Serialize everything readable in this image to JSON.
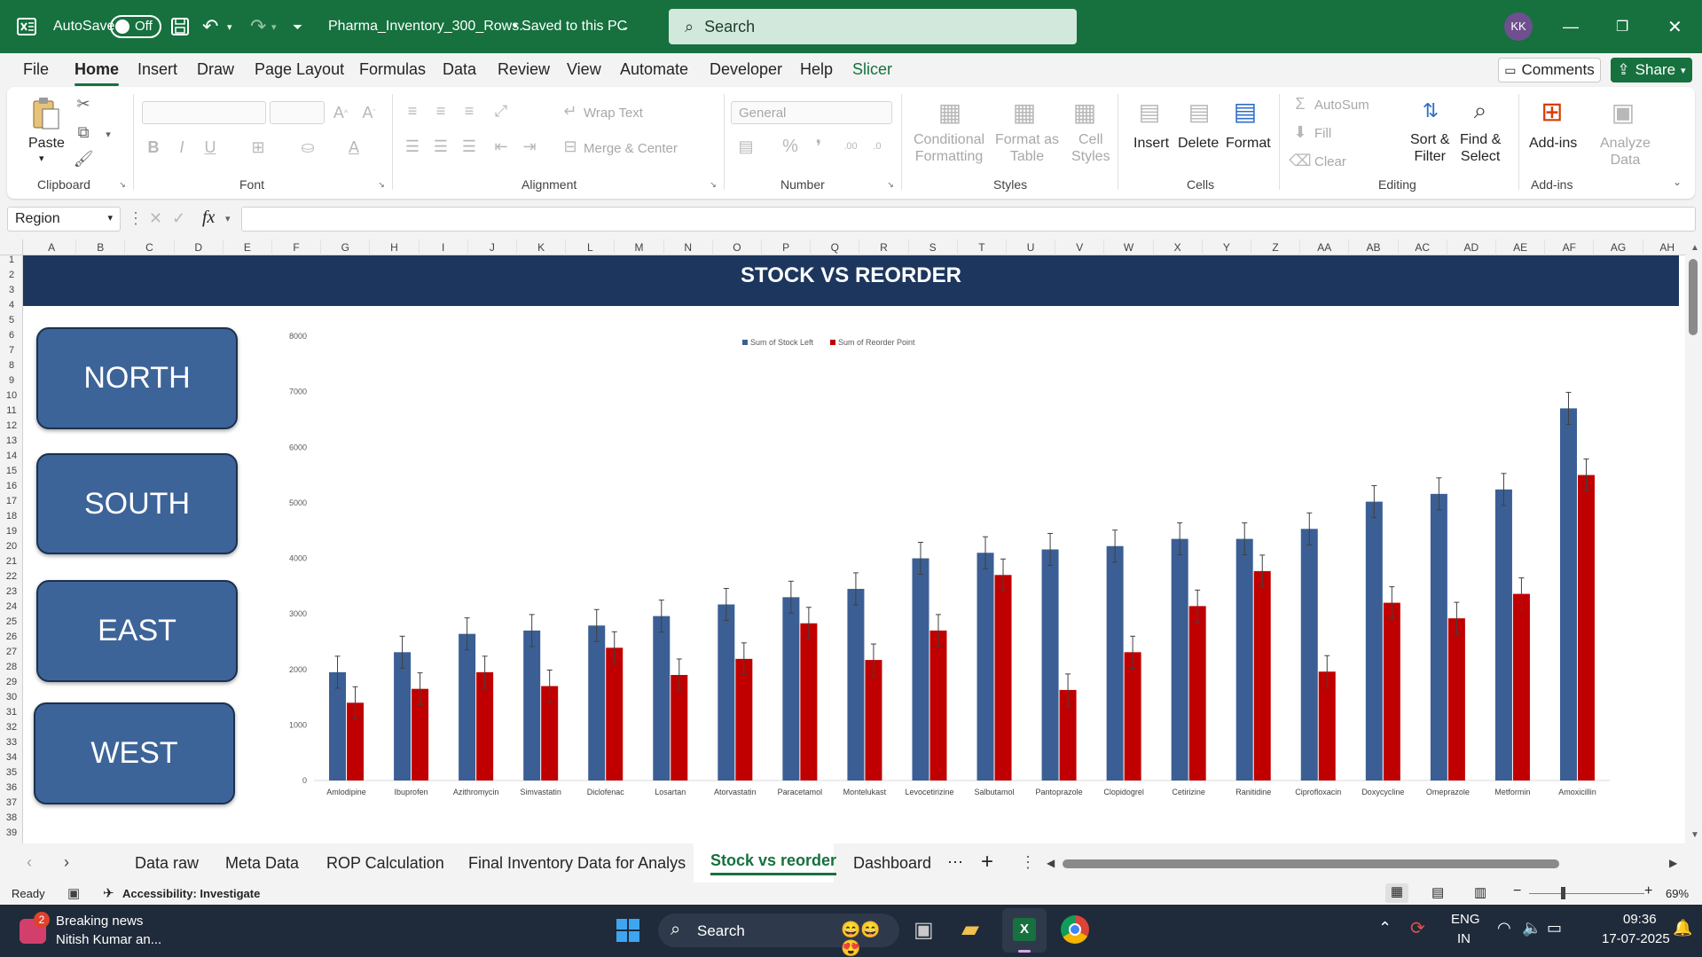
{
  "titlebar": {
    "autosave_label": "AutoSave",
    "autosave_state": "Off",
    "filename": "Pharma_Inventory_300_Rows...",
    "save_status": "• Saved to this PC",
    "search_placeholder": "Search",
    "avatar_initials": "KK"
  },
  "menu": [
    "File",
    "Home",
    "Insert",
    "Draw",
    "Page Layout",
    "Formulas",
    "Data",
    "Review",
    "View",
    "Automate",
    "Developer",
    "Help",
    "Slicer"
  ],
  "menu_active": "Home",
  "menu_right": {
    "comments": "Comments",
    "share": "Share"
  },
  "ribbon": {
    "clipboard": {
      "paste": "Paste",
      "group": "Clipboard"
    },
    "font": {
      "group": "Font"
    },
    "alignment": {
      "wrap": "Wrap Text",
      "merge": "Merge & Center",
      "group": "Alignment"
    },
    "number": {
      "format": "General",
      "group": "Number"
    },
    "styles": {
      "cond1": "Conditional",
      "cond2": "Formatting",
      "fmt1": "Format as",
      "fmt2": "Table",
      "cell1": "Cell",
      "cell2": "Styles",
      "group": "Styles"
    },
    "cells": {
      "insert": "Insert",
      "delete": "Delete",
      "format": "Format",
      "group": "Cells"
    },
    "editing": {
      "autosum": "AutoSum",
      "fill": "Fill",
      "clear": "Clear",
      "sort1": "Sort &",
      "sort2": "Filter",
      "find1": "Find &",
      "find2": "Select",
      "group": "Editing"
    },
    "addins": {
      "addins": "Add-ins",
      "analyze1": "Analyze",
      "analyze2": "Data",
      "group": "Add-ins"
    }
  },
  "formula_bar": {
    "name_box": "Region",
    "formula": ""
  },
  "columns": [
    "A",
    "B",
    "C",
    "D",
    "E",
    "F",
    "G",
    "H",
    "I",
    "J",
    "K",
    "L",
    "M",
    "N",
    "O",
    "P",
    "Q",
    "R",
    "S",
    "T",
    "U",
    "V",
    "W",
    "X",
    "Y",
    "Z",
    "AA",
    "AB",
    "AC",
    "AD",
    "AE",
    "AF",
    "AG",
    "AH"
  ],
  "rows": [
    "1",
    "2",
    "3",
    "4",
    "5",
    "6",
    "7",
    "8",
    "9",
    "10",
    "11",
    "12",
    "13",
    "14",
    "15",
    "16",
    "17",
    "18",
    "19",
    "20",
    "21",
    "22",
    "23",
    "24",
    "25",
    "26",
    "27",
    "28",
    "29",
    "30",
    "31",
    "32",
    "33",
    "34",
    "35",
    "36",
    "37",
    "38",
    "39"
  ],
  "banner_title": "STOCK VS REORDER",
  "slicers": [
    "NORTH",
    "SOUTH",
    "EAST",
    "WEST"
  ],
  "chart_data": {
    "type": "bar",
    "categories": [
      "Amlodipine",
      "Ibuprofen",
      "Azithromycin",
      "Simvastatin",
      "Diclofenac",
      "Losartan",
      "Atorvastatin",
      "Paracetamol",
      "Montelukast",
      "Levocetirizine",
      "Salbutamol",
      "Pantoprazole",
      "Clopidogrel",
      "Cetirizine",
      "Ranitidine",
      "Ciprofloxacin",
      "Doxycycline",
      "Omeprazole",
      "Metformin",
      "Amoxicillin"
    ],
    "series": [
      {
        "name": "Sum of Stock Left",
        "color": "#3b5f94",
        "values": [
          1950,
          2310,
          2640,
          2700,
          2790,
          2960,
          3170,
          3300,
          3450,
          4000,
          4100,
          4160,
          4220,
          4350,
          4350,
          4530,
          5020,
          5160,
          5240,
          6700
        ]
      },
      {
        "name": "Sum of Reorder Point",
        "color": "#c00000",
        "values": [
          1400,
          1650,
          1950,
          1700,
          2390,
          1900,
          2190,
          2830,
          2170,
          2700,
          3700,
          1630,
          2310,
          3140,
          3770,
          1960,
          3200,
          2920,
          3360,
          5500
        ]
      }
    ],
    "y_ticks": [
      "0",
      "1000",
      "2000",
      "3000",
      "4000",
      "5000",
      "6000",
      "7000",
      "8000"
    ],
    "ylim": [
      0,
      8000
    ],
    "error_bars": true,
    "legend_position": "top"
  },
  "sheet_tabs": [
    "Data raw",
    "Meta Data",
    "ROP Calculation",
    "Final Inventory Data for Analys",
    "Stock vs reorder",
    "Dashboard"
  ],
  "active_tab": "Stock vs reorder",
  "status": {
    "ready": "Ready",
    "accessibility": "Accessibility: Investigate",
    "zoom": "69%"
  },
  "taskbar": {
    "news_title": "Breaking news",
    "news_sub": "Nitish Kumar an...",
    "news_badge": "2",
    "search": "Search",
    "lang1": "ENG",
    "lang2": "IN",
    "time": "09:36",
    "date": "17-07-2025"
  }
}
